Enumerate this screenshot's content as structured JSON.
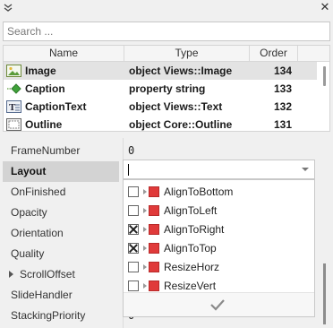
{
  "search": {
    "placeholder": "Search ..."
  },
  "grid": {
    "columns": [
      "Name",
      "Type",
      "Order"
    ],
    "rows": [
      {
        "name": "Image",
        "type": "object Views::Image",
        "order": "134",
        "icon": "image-icon"
      },
      {
        "name": "Caption",
        "type": "property string",
        "order": "133",
        "icon": "property-icon"
      },
      {
        "name": "CaptionText",
        "type": "object Views::Text",
        "order": "132",
        "icon": "text-icon"
      },
      {
        "name": "Outline",
        "type": "object Core::Outline",
        "order": "131",
        "icon": "outline-icon"
      }
    ]
  },
  "properties": {
    "rows": [
      {
        "name": "FrameNumber",
        "value": "0"
      },
      {
        "name": "Layout",
        "value": ""
      },
      {
        "name": "OnFinished",
        "value": ""
      },
      {
        "name": "Opacity",
        "value": ""
      },
      {
        "name": "Orientation",
        "value": ""
      },
      {
        "name": "Quality",
        "value": ""
      },
      {
        "name": "ScrollOffset",
        "value": ""
      },
      {
        "name": "SlideHandler",
        "value": ""
      },
      {
        "name": "StackingPriority",
        "value": "0"
      }
    ]
  },
  "editor": {
    "value": ""
  },
  "dropdown": {
    "items": [
      {
        "label": "AlignToBottom",
        "checked": false
      },
      {
        "label": "AlignToLeft",
        "checked": false
      },
      {
        "label": "AlignToRight",
        "checked": true
      },
      {
        "label": "AlignToTop",
        "checked": true
      },
      {
        "label": "ResizeHorz",
        "checked": false
      },
      {
        "label": "ResizeVert",
        "checked": false
      }
    ],
    "confirm_icon": "checkmark-icon"
  },
  "colors": {
    "flag": "#e03a3a",
    "selected_row": "#e3e3e3",
    "active_prop": "#d3d3d3"
  }
}
